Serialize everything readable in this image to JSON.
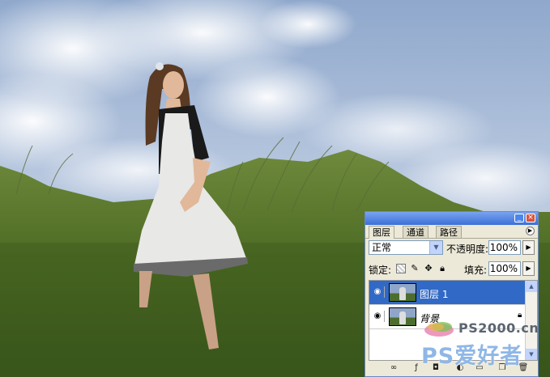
{
  "layers_panel": {
    "tabs": [
      {
        "label": "图层",
        "active": true
      },
      {
        "label": "通道",
        "active": false
      },
      {
        "label": "路径",
        "active": false
      }
    ],
    "blend_mode": "正常",
    "opacity_label": "不透明度:",
    "opacity_value": "100%",
    "lock_label": "锁定:",
    "fill_label": "填充:",
    "fill_value": "100%",
    "layers": [
      {
        "name": "图层 1",
        "selected": true,
        "visible": true,
        "locked": false
      },
      {
        "name": "背景",
        "selected": false,
        "visible": true,
        "locked": true
      }
    ],
    "colors": {
      "title_bar": "#3a6fd6",
      "selection": "#3169c6",
      "panel_bg": "#ece9d8"
    }
  },
  "watermark": {
    "site": "PS2000.cn",
    "brand": "PS爱好者"
  },
  "icons": [
    "eye-icon",
    "lock-icon",
    "brush-icon",
    "move-icon",
    "link-icon",
    "fx-icon",
    "mask-icon",
    "adjustment-icon",
    "folder-icon",
    "new-layer-icon",
    "trash-icon"
  ]
}
